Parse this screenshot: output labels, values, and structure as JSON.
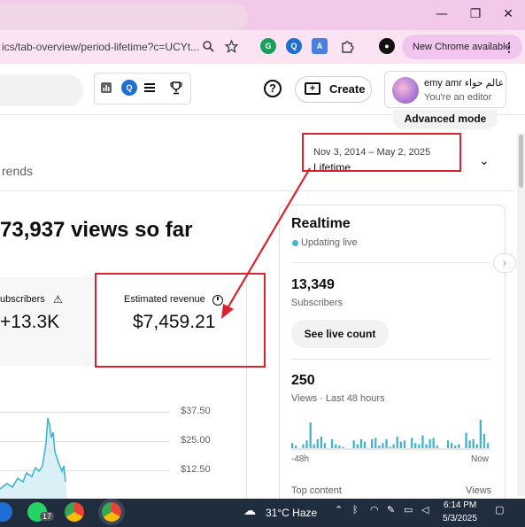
{
  "browser": {
    "window_controls": {
      "minimize": "—",
      "restore": "❐",
      "close": "✕"
    },
    "url": "ics/tab-overview/period-lifetime?c=UCYt...",
    "chrome_available_label": "New Chrome available",
    "menu_dots": "⋮"
  },
  "studio_header": {
    "help_label": "?",
    "create_label": "Create",
    "account_name": "emy amr عالم حواء",
    "account_role": "You're an editor"
  },
  "analytics": {
    "advanced_mode_label": "Advanced mode",
    "tab_label": "rends",
    "period_dates": "Nov 3, 2014 – May 2, 2025",
    "period_name": "Lifetime",
    "headline": "73,937 views so far",
    "subscribers_label": "ubscribers",
    "subscribers_value": "+13.3K",
    "revenue_label": "Estimated revenue",
    "revenue_value": "$7,459.21",
    "y_ticks": [
      "$37.50",
      "$25.00",
      "$12.50"
    ]
  },
  "realtime": {
    "title": "Realtime",
    "status": "Updating live",
    "subscribers_count": "13,349",
    "subscribers_label": "Subscribers",
    "live_count_button": "See live count",
    "views_count": "250",
    "views_label": "Views · Last 48 hours",
    "axis_start": "-48h",
    "axis_end": "Now",
    "top_content_label": "Top content",
    "views_col_label": "Views",
    "bars": [
      4,
      2,
      0,
      3,
      6,
      20,
      3,
      7,
      9,
      4,
      0,
      7,
      3,
      2,
      1,
      0,
      0,
      6,
      3,
      7,
      5,
      0,
      7,
      8,
      2,
      4,
      7,
      1,
      3,
      9,
      5,
      6,
      0,
      8,
      4,
      3,
      10,
      3,
      7,
      8,
      2,
      0,
      0,
      6,
      4,
      2,
      3,
      0,
      12,
      6,
      7,
      3,
      22,
      11,
      4
    ]
  },
  "taskbar": {
    "badge_count": "17",
    "weather": "31°C  Haze",
    "time": "6:14 PM",
    "date": "5/3/2025"
  },
  "colors": {
    "annotation_red": "#d9232e",
    "chart_blue": "#41b4d2",
    "titlebar_pink": "#f3c9ea"
  }
}
